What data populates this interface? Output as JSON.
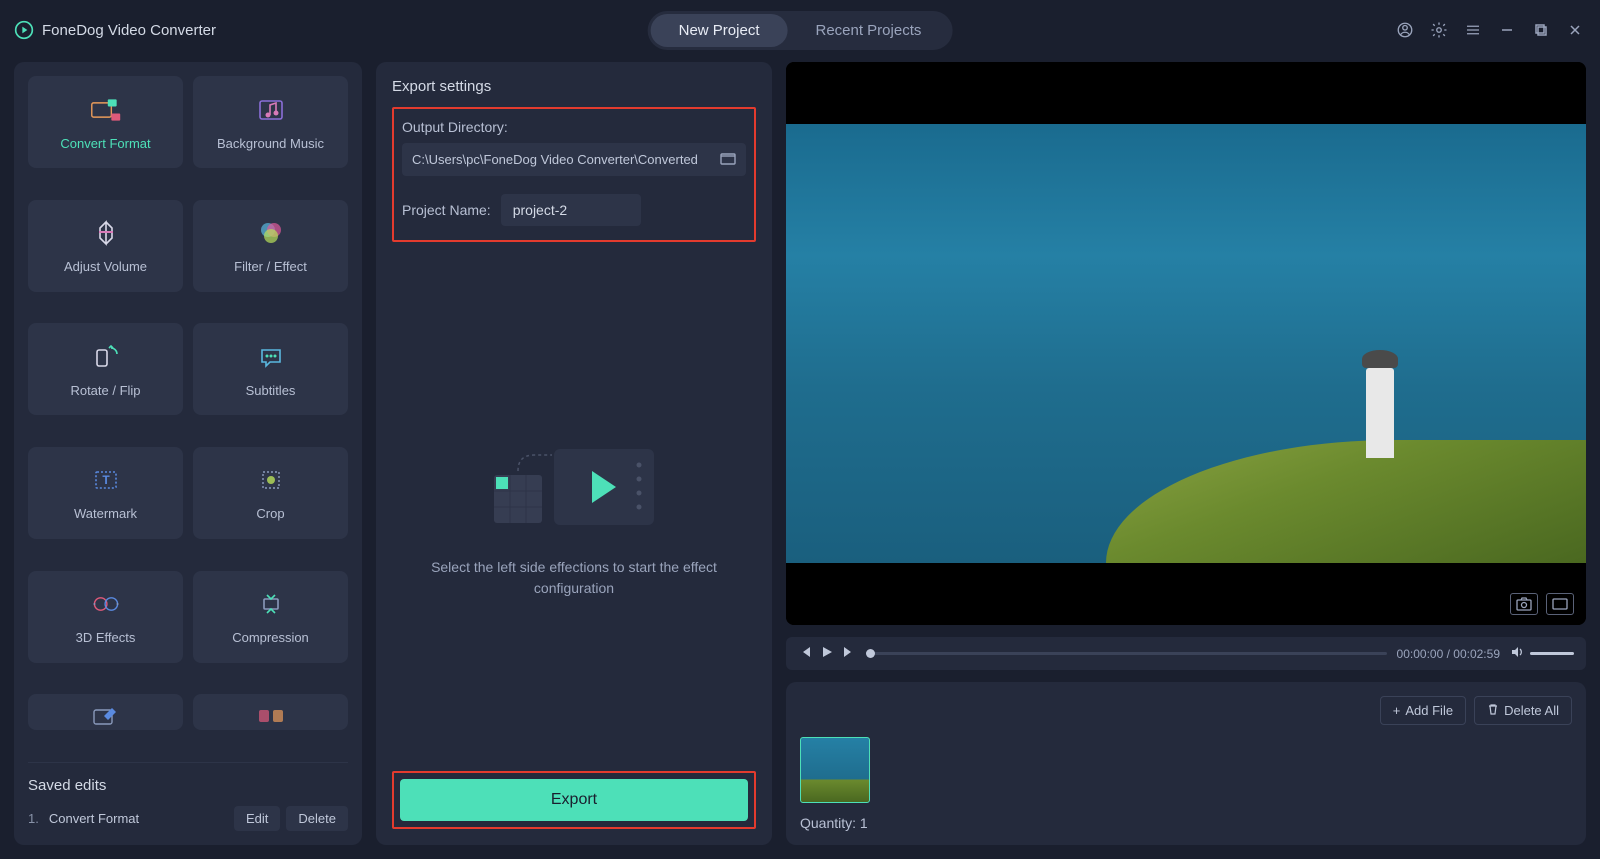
{
  "app": {
    "title": "FoneDog Video Converter"
  },
  "tabs": {
    "new": "New Project",
    "recent": "Recent Projects"
  },
  "tools": {
    "convert_format": "Convert Format",
    "background_music": "Background Music",
    "adjust_volume": "Adjust Volume",
    "filter_effect": "Filter / Effect",
    "rotate_flip": "Rotate / Flip",
    "subtitles": "Subtitles",
    "watermark": "Watermark",
    "crop": "Crop",
    "three_d_effects": "3D Effects",
    "compression": "Compression"
  },
  "saved": {
    "title": "Saved edits",
    "items": [
      {
        "index": "1.",
        "name": "Convert Format"
      }
    ],
    "edit": "Edit",
    "delete": "Delete"
  },
  "export": {
    "title": "Export settings",
    "output_label": "Output Directory:",
    "output_path": "C:\\Users\\pc\\FoneDog Video Converter\\Converted",
    "project_label": "Project Name:",
    "project_name": "project-2",
    "empty_text": "Select the left side effections to start the effect configuration",
    "button": "Export"
  },
  "player": {
    "current": "00:00:00",
    "separator": " / ",
    "total": "00:02:59"
  },
  "files": {
    "add_file": "Add File",
    "delete_all": "Delete All",
    "quantity_label": "Quantity: ",
    "quantity_value": "1"
  }
}
